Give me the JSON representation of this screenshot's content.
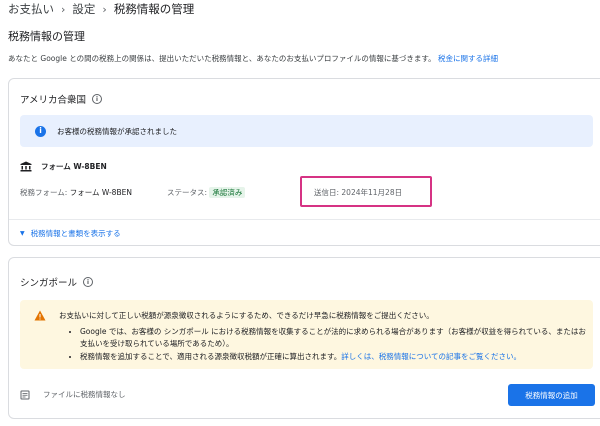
{
  "breadcrumb": {
    "items": [
      "お支払い",
      "設定",
      "税務情報の管理"
    ]
  },
  "page": {
    "title": "税務情報の管理",
    "description": "あなたと Google との間の税務上の関係は、提出いただいた税務情報と、あなたのお支払いプロファイルの情報に基づきます。",
    "description_link": "税金に関する詳細"
  },
  "us_section": {
    "title": "アメリカ合衆国",
    "banner_text": "お客様の税務情報が承認されました",
    "form_name": "フォーム W-8BEN",
    "tax_form_label": "税務フォーム:",
    "tax_form_value": "フォーム W-8BEN",
    "status_label": "ステータス:",
    "status_value": "承認済み",
    "sent_date": "送信日: 2024年11月28日",
    "expand_link": "税務情報と書類を表示する"
  },
  "sg_section": {
    "title": "シンガポール",
    "warning_main": "お支払いに対して正しい税額が源泉徴収されるようにするため、できるだけ早急に税務情報をご提出ください。",
    "bullet1": "Google では、お客様の シンガポール における税務情報を収集することが法的に求められる場合があります（お客様が収益を得られている、またはお支払いを受け取られている場所であるため）。",
    "bullet2_text": "税務情報を追加することで、適用される源泉徴収税額が正確に算出されます。",
    "bullet2_link": "詳しくは、税務情報についての記事をご覧ください。",
    "file_status": "ファイルに税務情報なし",
    "add_button": "税務情報の追加"
  },
  "colors": {
    "accent": "#1a73e8",
    "highlight": "#d63384",
    "info_bg": "#e8f0fe",
    "warning_bg": "#fef7e0",
    "success": "#137333"
  }
}
